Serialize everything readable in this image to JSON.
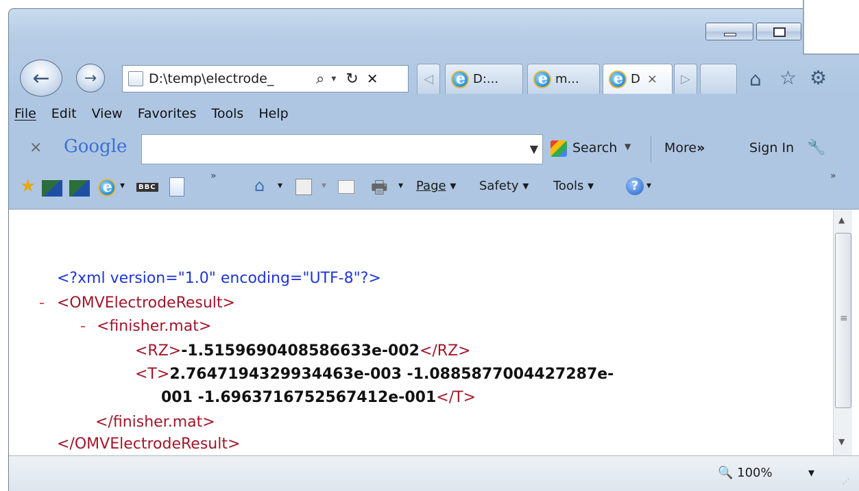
{
  "address": {
    "url": "D:\\temp\\electrode_",
    "search_glyph": "⌕",
    "dropdown_glyph": "▾",
    "refresh_glyph": "↻",
    "stop_glyph": "✕"
  },
  "tabs": [
    {
      "title": "D:..."
    },
    {
      "title": "m..."
    },
    {
      "title": "D",
      "close": "×"
    }
  ],
  "menu": {
    "items": [
      {
        "label": "File"
      },
      {
        "label": "Edit"
      },
      {
        "label": "View"
      },
      {
        "label": "Favorites"
      },
      {
        "label": "Tools"
      },
      {
        "label": "Help"
      }
    ]
  },
  "google_toolbar": {
    "close": "×",
    "brand": "Google",
    "search_label": "Search",
    "more_label": "More",
    "more_glyph": "»",
    "signin_label": "Sign In"
  },
  "command_bar": {
    "overflow_left": "»",
    "page_label": "Page",
    "safety_label": "Safety",
    "tools_label": "Tools",
    "overflow_right": "»",
    "bbc": "BBC",
    "arrow": "▾"
  },
  "xml": {
    "declaration": "<?xml version=\"1.0\" encoding=\"UTF-8\"?>",
    "collapse_marker": "-",
    "root_open": "<OMVElectrodeResult>",
    "child_open": "<finisher.mat>",
    "rz_open": "<RZ>",
    "rz_value": "-1.5159690408586633e-002",
    "rz_close": "</RZ>",
    "t_open": "<T>",
    "t_value_line1": "2.7647194329934463e-003 -1.0885877004427287e-",
    "t_value_line2": "001 -1.6963716752567412e-001",
    "t_close": "</T>",
    "child_close": "</finisher.mat>",
    "root_close": "</OMVElectrodeResult>"
  },
  "status": {
    "zoom": "100%",
    "zoom_arrow": "▾"
  },
  "colors": {
    "tag_blue": "#1e34d6",
    "element_red": "#a0162a",
    "chrome_blue": "#b7cde6"
  }
}
